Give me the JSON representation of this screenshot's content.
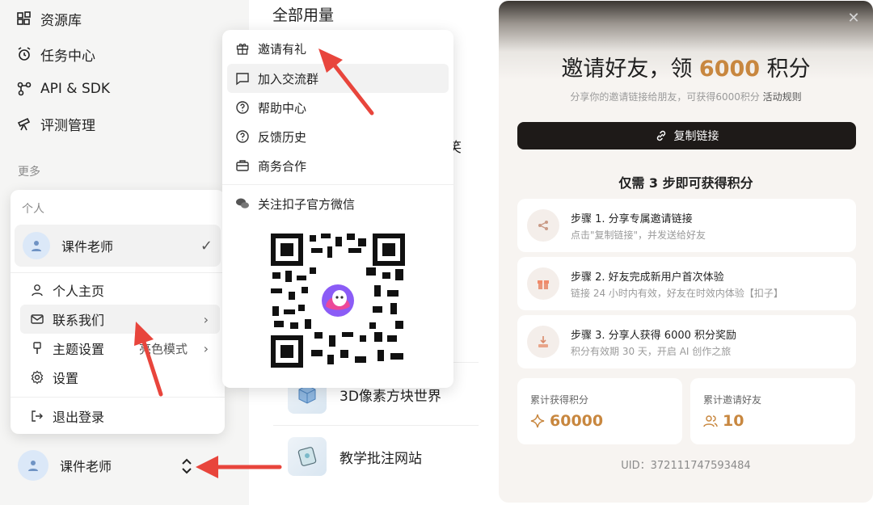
{
  "sidebar": {
    "items": [
      {
        "label": "资源库",
        "icon": "library-icon"
      },
      {
        "label": "任务中心",
        "icon": "alarm-icon"
      },
      {
        "label": "API & SDK",
        "icon": "api-icon"
      },
      {
        "label": "评测管理",
        "icon": "telescope-icon"
      }
    ],
    "section_label": "更多"
  },
  "main": {
    "title": "全部用量",
    "apps": [
      {
        "label": "3D像素方块世界"
      },
      {
        "label": "教学批注网站"
      }
    ],
    "partial_text": "笑"
  },
  "account_menu": {
    "section_label": "个人",
    "user_name": "课件老师",
    "items": [
      {
        "label": "个人主页"
      },
      {
        "label": "联系我们"
      },
      {
        "label": "主题设置",
        "note": "亮色模式"
      },
      {
        "label": "设置"
      },
      {
        "label": "退出登录"
      }
    ]
  },
  "bottom_user": {
    "name": "课件老师"
  },
  "submenu": {
    "items": [
      {
        "label": "邀请有礼"
      },
      {
        "label": "加入交流群"
      },
      {
        "label": "帮助中心"
      },
      {
        "label": "反馈历史"
      },
      {
        "label": "商务合作"
      },
      {
        "label": "关注扣子官方微信"
      }
    ]
  },
  "modal": {
    "title_pre": "邀请好友，领 ",
    "title_amount": "6000",
    "title_post": " 积分",
    "subtitle": "分享你的邀请链接给朋友，可获得6000积分 ",
    "rule_link": "活动规则",
    "copy_button": "复制链接",
    "steps_heading": "仅需 3 步即可获得积分",
    "steps": [
      {
        "title": "步骤 1. 分享专属邀请链接",
        "desc": "点击\"复制链接\"，并发送给好友"
      },
      {
        "title": "步骤 2. 好友完成新用户首次体验",
        "desc": "链接 24 小时内有效，好友在时效内体验【扣子】"
      },
      {
        "title": "步骤 3. 分享人获得 6000 积分奖励",
        "desc": "积分有效期 30 天，开启 AI 创作之旅"
      }
    ],
    "stats": [
      {
        "label": "累计获得积分",
        "value": "60000"
      },
      {
        "label": "累计邀请好友",
        "value": "10"
      }
    ],
    "uid": "UID：372111747593484"
  },
  "colors": {
    "accent": "#c8873f",
    "arrow": "#e8453c",
    "dark_button": "#1e1a18"
  }
}
